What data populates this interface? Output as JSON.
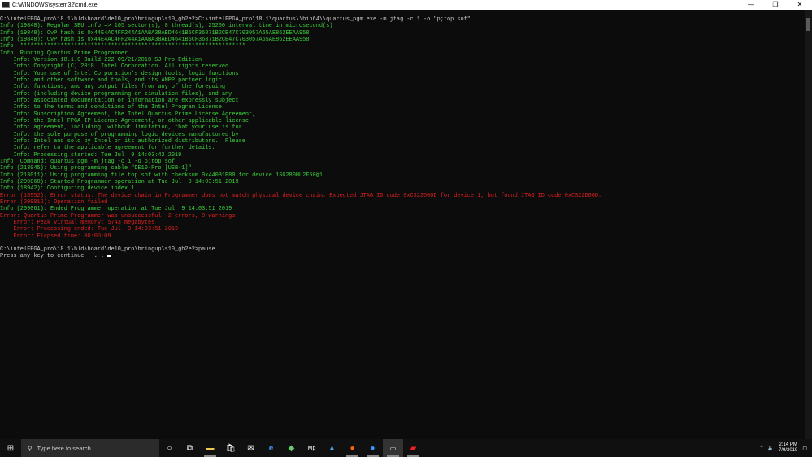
{
  "window": {
    "title": "C:\\WINDOWS\\system32\\cmd.exe",
    "minimize": "—",
    "maximize": "❐",
    "close": "✕"
  },
  "console": {
    "lines": [
      {
        "c": "w",
        "t": "C:\\intelFPGA_pro\\18.1\\hld\\board\\de10_pro\\bringup\\s10_gh2e2>C:\\intelFPGA_pro\\18.1\\quartus\\\\bin64\\\\quartus_pgm.exe -m jtag -c 1 -o \"p;top.sof\""
      },
      {
        "c": "g",
        "t": "Info (19848): Regular SEU info => 105 sector(s), 8 thread(s), 25200 interval time in microsecond(s)"
      },
      {
        "c": "g",
        "t": "Info (19848): CvP hash is 0x44E4AC4FF244A1AABA38AED4641B5CF36871B2CE47C703057A65AE862EEAA958"
      },
      {
        "c": "g",
        "t": "Info (19848): CvP hash is 0x44E4AC4FF244A1AABA38AED4641B5CF36871B2CE47C703057A65AE862EEAA958"
      },
      {
        "c": "g",
        "t": "Info: *******************************************************************"
      },
      {
        "c": "g",
        "t": "Info: Running Quartus Prime Programmer"
      },
      {
        "c": "g",
        "t": "    Info: Version 18.1.0 Build 222 09/21/2018 SJ Pro Edition"
      },
      {
        "c": "g",
        "t": "    Info: Copyright (C) 2018  Intel Corporation. All rights reserved."
      },
      {
        "c": "g",
        "t": "    Info: Your use of Intel Corporation's design tools, logic functions"
      },
      {
        "c": "g",
        "t": "    Info: and other software and tools, and its AMPP partner logic"
      },
      {
        "c": "g",
        "t": "    Info: functions, and any output files from any of the foregoing"
      },
      {
        "c": "g",
        "t": "    Info: (including device programming or simulation files), and any"
      },
      {
        "c": "g",
        "t": "    Info: associated documentation or information are expressly subject"
      },
      {
        "c": "g",
        "t": "    Info: to the terms and conditions of the Intel Program License"
      },
      {
        "c": "g",
        "t": "    Info: Subscription Agreement, the Intel Quartus Prime License Agreement,"
      },
      {
        "c": "g",
        "t": "    Info: the Intel FPGA IP License Agreement, or other applicable license"
      },
      {
        "c": "g",
        "t": "    Info: agreement, including, without limitation, that your use is for"
      },
      {
        "c": "g",
        "t": "    Info: the sole purpose of programming logic devices manufactured by"
      },
      {
        "c": "g",
        "t": "    Info: Intel and sold by Intel or its authorized distributors.  Please"
      },
      {
        "c": "g",
        "t": "    Info: refer to the applicable agreement for further details."
      },
      {
        "c": "g",
        "t": "    Info: Processing started: Tue Jul  9 14:03:42 2019"
      },
      {
        "c": "g",
        "t": "Info: Command: quartus_pgm -m jtag -c 1 -o p;top.sof"
      },
      {
        "c": "g",
        "t": "Info (213045): Using programming cable \"DE10-Pro [USB-1]\""
      },
      {
        "c": "g",
        "t": "Info (213011): Using programming file top.sof with checksum 0x440B1E80 for device 1SG280HU2F50@1"
      },
      {
        "c": "g",
        "t": "Info (209060): Started Programmer operation at Tue Jul  9 14:03:51 2019"
      },
      {
        "c": "g",
        "t": "Info (18942): Configuring device index 1"
      },
      {
        "c": "r",
        "t": "Error (18952): Error status: The device chain in Programmer does not match physical device chain. Expected JTAG ID code 0xC322500D for device 1, but found JTAG ID code 0xC322D00D."
      },
      {
        "c": "r",
        "t": "Error (209012): Operation failed"
      },
      {
        "c": "g",
        "t": "Info (209061): Ended Programmer operation at Tue Jul  9 14:03:51 2019"
      },
      {
        "c": "r",
        "t": "Error: Quartus Prime Programmer was unsuccessful. 2 errors, 0 warnings"
      },
      {
        "c": "r",
        "t": "    Error: Peak virtual memory: 5743 megabytes"
      },
      {
        "c": "r",
        "t": "    Error: Processing ended: Tue Jul  9 14:03:51 2019"
      },
      {
        "c": "r",
        "t": "    Error: Elapsed time: 00:00:09"
      },
      {
        "c": "w",
        "t": ""
      },
      {
        "c": "w",
        "t": "C:\\intelFPGA_pro\\18.1\\hld\\board\\de10_pro\\bringup\\s10_gh2e2>pause"
      },
      {
        "c": "w",
        "t": "Press any key to continue . . . "
      }
    ]
  },
  "taskbar": {
    "search_placeholder": "Type here to search",
    "time": "2:14 PM",
    "date": "7/9/2019"
  }
}
